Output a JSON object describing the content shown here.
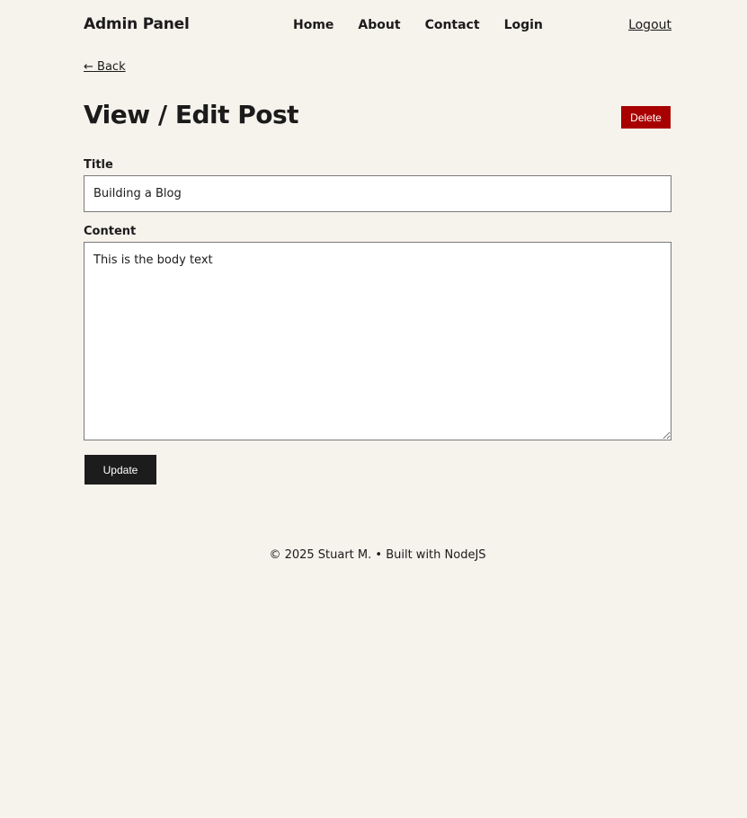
{
  "header": {
    "brand": "Admin Panel",
    "nav": [
      {
        "label": "Home"
      },
      {
        "label": "About"
      },
      {
        "label": "Contact"
      },
      {
        "label": "Login"
      }
    ],
    "logout_label": "Logout"
  },
  "back": {
    "arrow": "←",
    "label": "Back"
  },
  "page": {
    "title": "View / Edit Post",
    "delete_label": "Delete"
  },
  "form": {
    "title_label": "Title",
    "title_value": "Building a Blog",
    "content_label": "Content",
    "content_value": "This is the body text",
    "update_label": "Update"
  },
  "footer": {
    "text": "© 2025 Stuart M. • Built with NodeJS"
  },
  "colors": {
    "background": "#f6f2ec",
    "text": "#1b1b1b",
    "delete": "#a80000",
    "update": "#1c1c1c"
  }
}
